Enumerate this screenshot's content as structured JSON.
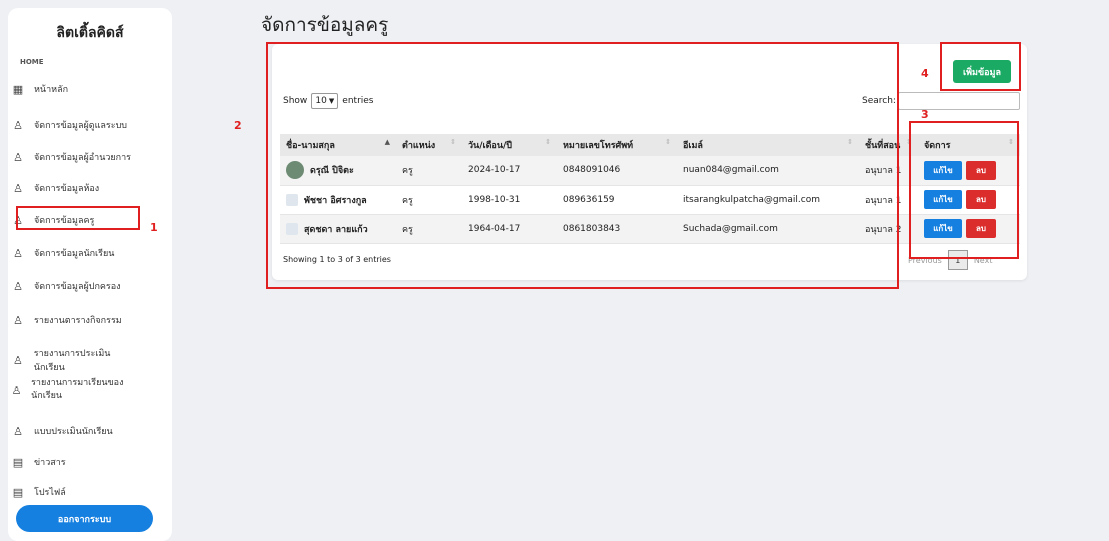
{
  "sidebar": {
    "brand": "ลิตเติ้ลคิดส์",
    "section": "HOME",
    "items": [
      {
        "label": "หน้าหลัก",
        "icon": "grid-icon"
      },
      {
        "label": "จัดการข้อมูลผู้ดูแลระบบ",
        "icon": "user-icon"
      },
      {
        "label": "จัดการข้อมูลผู้อำนวยการ",
        "icon": "user-icon"
      },
      {
        "label": "จัดการข้อมูลห้อง",
        "icon": "user-icon"
      },
      {
        "label": "จัดการข้อมูลครู",
        "icon": "user-icon"
      },
      {
        "label": "จัดการข้อมูลนักเรียน",
        "icon": "user-icon"
      },
      {
        "label": "จัดการข้อมูลผู้ปกครอง",
        "icon": "user-icon"
      },
      {
        "label": "รายงานตารางกิจกรรม",
        "icon": "user-icon"
      },
      {
        "label": "รายงานการประเมินนักเรียน",
        "icon": "user-icon"
      },
      {
        "label": "รายงานการมาเรียนของนักเรียน",
        "icon": "user-icon"
      },
      {
        "label": "แบบประเมินนักเรียน",
        "icon": "user-icon"
      },
      {
        "label": "ข่าวสาร",
        "icon": "list-icon"
      },
      {
        "label": "โปรไฟล์",
        "icon": "list-icon"
      }
    ],
    "logout_label": "ออกจากระบบ"
  },
  "main": {
    "title": "จัดการข้อมูลครู",
    "add_button": "เพิ่มข้อมูล",
    "show_label": "Show",
    "show_value": "10",
    "entries_label": "entries",
    "search_label": "Search:",
    "columns": [
      "ชื่อ-นามสกุล",
      "ตำแหน่ง",
      "วัน/เดือน/ปี",
      "หมายเลขโทรศัพท์",
      "อีเมล์",
      "ชั้นที่สอน",
      "จัดการ"
    ],
    "rows": [
      {
        "name": "ดรุณี ปิจิตะ",
        "position": "ครู",
        "date": "2024-10-17",
        "phone": "0848091046",
        "email": "nuan084@gmail.com",
        "class": "อนุบาล 1"
      },
      {
        "name": "พัชชา อิศรางกูล",
        "position": "ครู",
        "date": "1998-10-31",
        "phone": "089636159",
        "email": "itsarangkulpatcha@gmail.com",
        "class": "อนุบาล 1"
      },
      {
        "name": "สุดชดา ลายแก้ว",
        "position": "ครู",
        "date": "1964-04-17",
        "phone": "0861803843",
        "email": "Suchada@gmail.com",
        "class": "อนุบาล 2"
      }
    ],
    "edit_label": "แก้ไข",
    "delete_label": "ลบ",
    "info": "Showing 1 to 3 of 3 entries",
    "pager": {
      "prev": "Previous",
      "page": "1",
      "next": "Next"
    }
  },
  "annotations": [
    "1",
    "2",
    "3",
    "4"
  ],
  "colors": {
    "primary": "#1680e0",
    "success": "#1aaa63",
    "danger": "#dc2d2d",
    "annotation": "#e02020"
  }
}
